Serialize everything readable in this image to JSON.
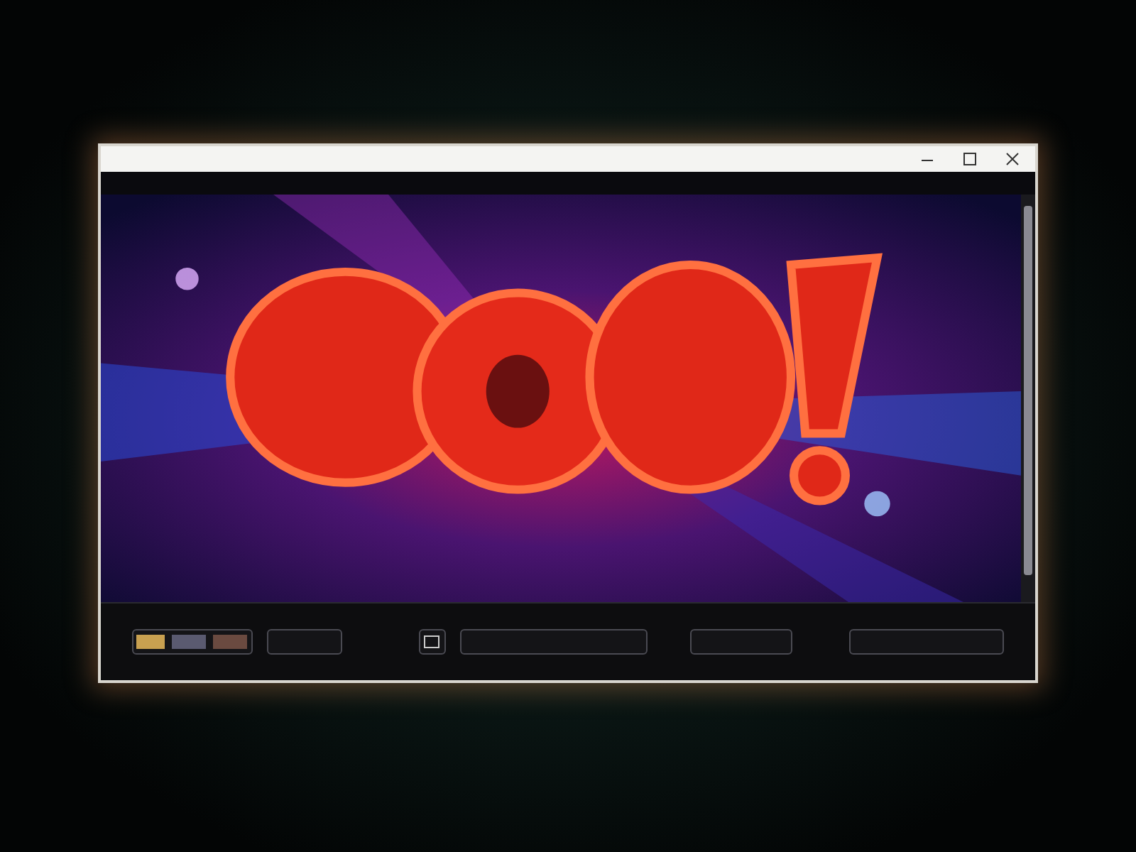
{
  "window": {
    "controls": [
      {
        "kind": "minimize"
      },
      {
        "kind": "maximize"
      },
      {
        "kind": "close"
      }
    ]
  },
  "bottom_bar": {
    "items": [
      {
        "kind": "thumbs"
      },
      {
        "kind": "field"
      },
      {
        "kind": "icon"
      },
      {
        "kind": "wide"
      },
      {
        "kind": "medium"
      },
      {
        "kind": "large"
      }
    ]
  }
}
